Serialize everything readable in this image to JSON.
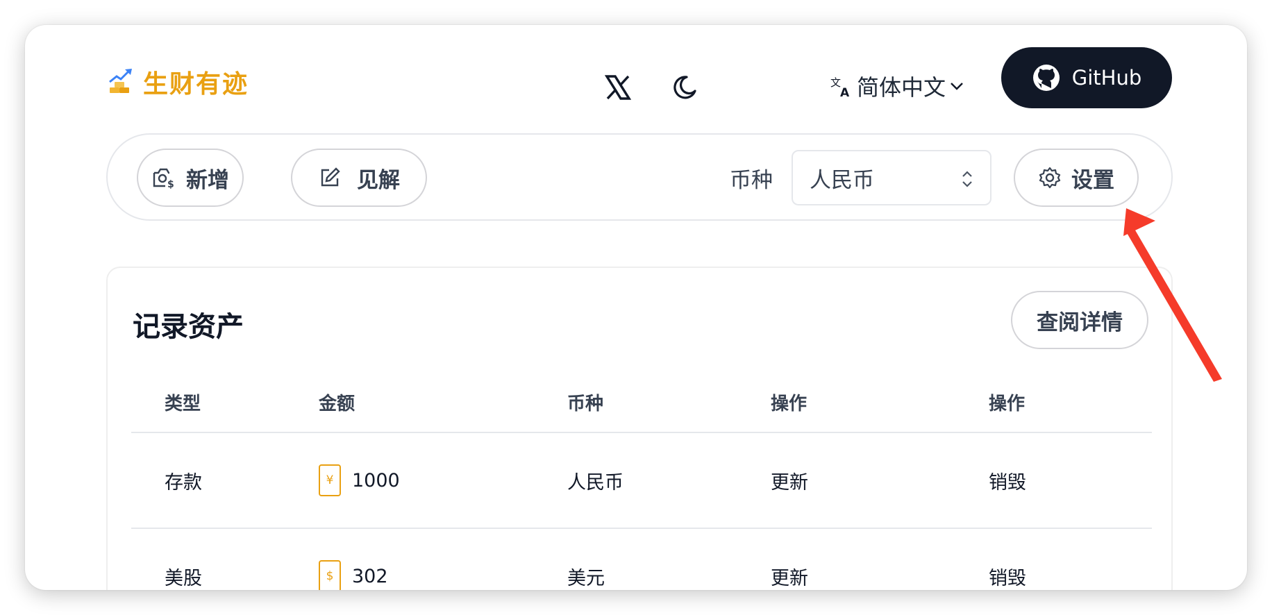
{
  "header": {
    "brand": "生财有迹",
    "language": "简体中文",
    "github_label": "GitHub",
    "icons": {
      "logo": "money-growth-icon",
      "x": "x-logo-icon",
      "theme": "moon-icon",
      "translate": "translate-icon",
      "chevron": "chevron-down-icon",
      "github": "github-icon"
    }
  },
  "toolbar": {
    "add_label": "新增",
    "insight_label": "见解",
    "currency_label": "币种",
    "currency_value": "人民币",
    "settings_label": "设置"
  },
  "card": {
    "title": "记录资产",
    "details_label": "查阅详情",
    "columns": [
      "类型",
      "金额",
      "币种",
      "操作",
      "操作"
    ],
    "rows": [
      {
        "type": "存款",
        "symbol": "¥",
        "amount": "1000",
        "currency": "人民币",
        "update": "更新",
        "delete": "销毁"
      },
      {
        "type": "美股",
        "symbol": "$",
        "amount": "302",
        "currency": "美元",
        "update": "更新",
        "delete": "销毁"
      }
    ]
  },
  "colors": {
    "brand": "#e9a012",
    "dark_button": "#111827",
    "action_pink": "#ec4899",
    "annotation_arrow": "#f53b2a"
  }
}
